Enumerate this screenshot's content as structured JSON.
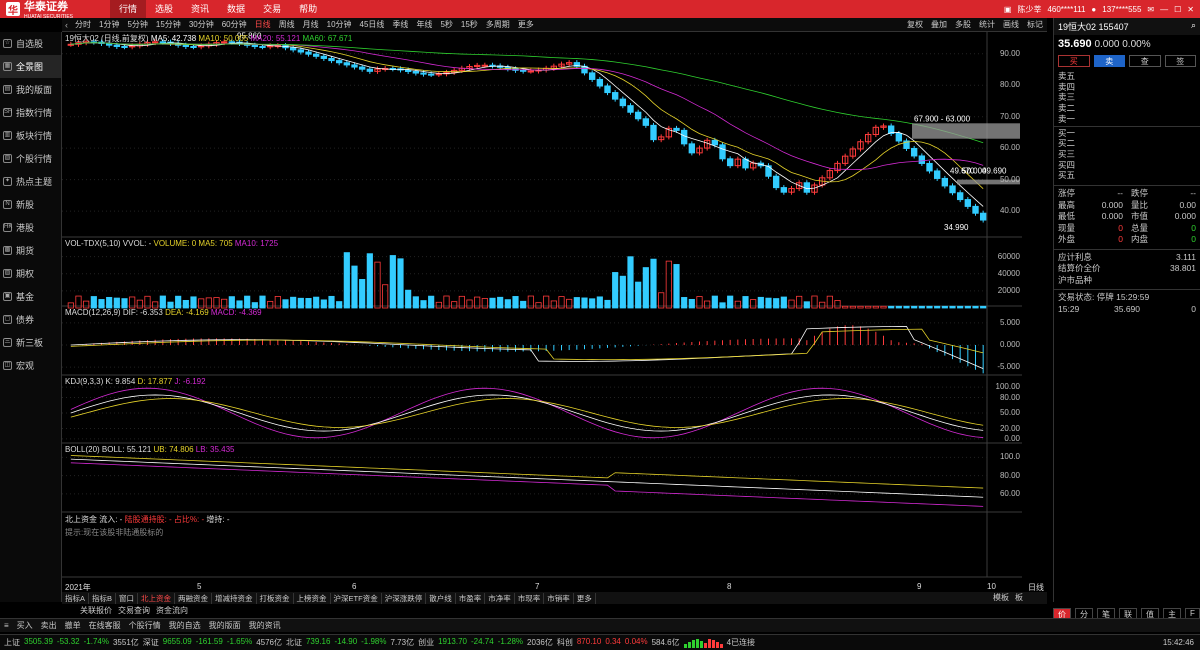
{
  "brand": {
    "name": "华泰证券",
    "sub": "HUATAI SECURITIES"
  },
  "menu": [
    {
      "label": "行情",
      "active": true
    },
    {
      "label": "选股"
    },
    {
      "label": "资讯"
    },
    {
      "label": "数据"
    },
    {
      "label": "交易"
    },
    {
      "label": "帮助"
    }
  ],
  "topright": {
    "user": "陈少莘",
    "account": "460****111",
    "user2": "137****555"
  },
  "periods": [
    {
      "label": "分时"
    },
    {
      "label": "1分钟"
    },
    {
      "label": "5分钟"
    },
    {
      "label": "15分钟"
    },
    {
      "label": "30分钟"
    },
    {
      "label": "60分钟"
    },
    {
      "label": "日线",
      "active": true
    },
    {
      "label": "周线"
    },
    {
      "label": "月线"
    },
    {
      "label": "10分钟"
    },
    {
      "label": "45日线"
    },
    {
      "label": "季线"
    },
    {
      "label": "年线"
    },
    {
      "label": "5秒"
    },
    {
      "label": "15秒"
    },
    {
      "label": "多周期"
    },
    {
      "label": "更多"
    }
  ],
  "chart_tools": [
    "复权",
    "叠加",
    "多股",
    "统计",
    "画线",
    "标记"
  ],
  "sidebar": [
    {
      "label": "自选股"
    },
    {
      "label": "全景图",
      "active": true
    },
    {
      "label": "我的版面"
    },
    {
      "label": "指数行情"
    },
    {
      "label": "板块行情"
    },
    {
      "label": "个股行情"
    },
    {
      "label": "热点主题"
    },
    {
      "label": "新股"
    },
    {
      "label": "港股"
    },
    {
      "label": "期货"
    },
    {
      "label": "期权"
    },
    {
      "label": "基金"
    },
    {
      "label": "债券"
    },
    {
      "label": "新三板"
    },
    {
      "label": "宏观"
    }
  ],
  "panels": {
    "main": {
      "title": "19恒大02 (日线,前复权)",
      "ma5": "MA5: 42.738",
      "ma10": "MA10: 50.005",
      "ma20": "MA20: 55.121",
      "ma60": "MA60: 67.671",
      "ticks": [
        "90.00",
        "80.00",
        "70.00",
        "60.00",
        "50.00",
        "40.00"
      ],
      "ann_high": "95.860",
      "ann_range": "67.900 - 63.000",
      "ann_mid": "49.670",
      "ann_mid2": "50.000",
      "ann_mid3": "49.690",
      "ann_low": "34.990"
    },
    "vol": {
      "title": "VOL-TDX(5,10) VVOL: -",
      "volume": "VOLUME: 0",
      "ma5": "MA5: 705",
      "ma10": "MA10: 1725",
      "ticks": [
        "60000",
        "40000",
        "20000"
      ]
    },
    "macd": {
      "title": "MACD(12,26,9)",
      "dif": "DIF: -6.353",
      "dea": "DEA: -4.169",
      "macd": "MACD: -4.369",
      "ticks": [
        "5.000",
        "0.000",
        "-5.000"
      ]
    },
    "kdj": {
      "title": "KDJ(9,3,3)",
      "k": "K: 9.854",
      "d": "D: 17.877",
      "j": "J: -6.192",
      "ticks": [
        "100.00",
        "80.00",
        "50.00",
        "20.00",
        "0.00"
      ]
    },
    "boll": {
      "title": "BOLL(20)",
      "boll": "BOLL: 55.121",
      "ub": "UB: 74.806",
      "lb": "LB: 35.435",
      "ticks": [
        "100.0",
        "80.00",
        "60.00"
      ]
    },
    "north": {
      "title": "北上资金",
      "inflow": "流入: -",
      "hold": "陆股通持股: -",
      "ratio": "占比%: -",
      "add": "增持: -",
      "hint": "提示:现在该股非陆通股标的"
    }
  },
  "xaxis": [
    "2021年",
    "5",
    "6",
    "7",
    "8",
    "9",
    "10"
  ],
  "xaxis_right": "日线",
  "bottom_tabs": [
    {
      "label": "指标A"
    },
    {
      "label": "指标B"
    },
    {
      "label": "窗口"
    },
    {
      "label": "北上资金",
      "active": true
    },
    {
      "label": "两融资金"
    },
    {
      "label": "增减持资金"
    },
    {
      "label": "打板资金"
    },
    {
      "label": "上榜资金"
    },
    {
      "label": "沪深ETF资金"
    },
    {
      "label": "沪深涨跌停"
    },
    {
      "label": "散户线"
    },
    {
      "label": "市盈率"
    },
    {
      "label": "市净率"
    },
    {
      "label": "市现率"
    },
    {
      "label": "市销率"
    },
    {
      "label": "更多"
    }
  ],
  "bottom_right": [
    "模板",
    "板"
  ],
  "sub_tabs": [
    "关联报价",
    "交易查询",
    "资金流向"
  ],
  "right_panel": {
    "name": "19恒大02",
    "code": "155407",
    "price": "35.690",
    "chg": "0.000",
    "pct": "0.00%",
    "buttons": [
      "买",
      "卖",
      "查",
      "签"
    ],
    "sell": [
      "卖五",
      "卖四",
      "卖三",
      "卖二",
      "卖一"
    ],
    "buy": [
      "买一",
      "买二",
      "买三",
      "买四",
      "买五"
    ],
    "stats": [
      [
        "涨停",
        "--",
        "跌停",
        "--"
      ],
      [
        "最高",
        "0.000",
        "量比",
        "0.00"
      ],
      [
        "最低",
        "0.000",
        "市值",
        "0.000"
      ],
      [
        "现量",
        "0",
        "总量",
        "0"
      ],
      [
        "外盘",
        "0",
        "内盘",
        "0"
      ]
    ],
    "accrued_label": "应计利息",
    "accrued": "3.111",
    "settle_label": "结算价全价",
    "settle": "38.801",
    "market": "沪市品种",
    "trade_status": "交易状态: 停牌 15:29:59",
    "tick_time": "15:29",
    "tick_price": "35.690",
    "tick_vol": "0",
    "right_row": [
      "价",
      "分",
      "笔",
      "联",
      "值",
      "主",
      "F"
    ]
  },
  "trade_bar": [
    "买入",
    "卖出",
    "撤单",
    "在线客服",
    "个股行情",
    "我的自选",
    "我的版面",
    "我的资讯"
  ],
  "statusbar": {
    "items": [
      {
        "name": "上证",
        "val": "3505.39",
        "chg": "-53.32",
        "pct": "-1.74%",
        "amt": "3551亿"
      },
      {
        "name": "深证",
        "val": "9655.09",
        "chg": "-161.59",
        "pct": "-1.65%",
        "amt": "4576亿"
      },
      {
        "name": "北证",
        "val": "739.16",
        "chg": "-14.90",
        "pct": "-1.98%",
        "amt": "7.73亿"
      },
      {
        "name": "创业",
        "val": "1913.70",
        "chg": "-24.74",
        "pct": "-1.28%",
        "amt": "2036亿"
      },
      {
        "name": "科创",
        "val": "870.10",
        "chg": "0.34",
        "pct": "0.04%",
        "amt": "584.6亿"
      }
    ],
    "conn": "4已连接",
    "time": "15:42:46"
  },
  "colors": {
    "up": "#ff3b3b",
    "down": "#2fd12f",
    "ma5": "#ffffff",
    "ma10": "#e6d32a",
    "ma20": "#d42ad4",
    "ma60": "#2fd12f"
  }
}
